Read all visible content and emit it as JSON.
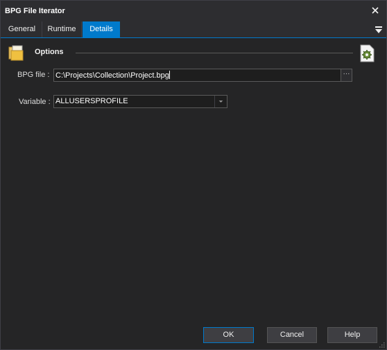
{
  "window": {
    "title": "BPG File Iterator"
  },
  "tabs": [
    {
      "label": "General"
    },
    {
      "label": "Runtime"
    },
    {
      "label": "Details"
    }
  ],
  "options": {
    "title": "Options"
  },
  "form": {
    "bpg_file": {
      "label": "BPG file :",
      "value": "C:\\Projects\\Collection\\Project.bpg",
      "browse_label": "···"
    },
    "variable": {
      "label": "Variable :",
      "value": "ALLUSERSPROFILE"
    }
  },
  "buttons": {
    "ok": "OK",
    "cancel": "Cancel",
    "help": "Help"
  },
  "colors": {
    "accent": "#007acc",
    "background": "#252526",
    "input": "#1e1e1e"
  },
  "icons": [
    "close-icon",
    "menu-icon",
    "options-folder-icon",
    "gear-document-icon",
    "dropdown-arrow-icon",
    "resize-grip-icon"
  ]
}
